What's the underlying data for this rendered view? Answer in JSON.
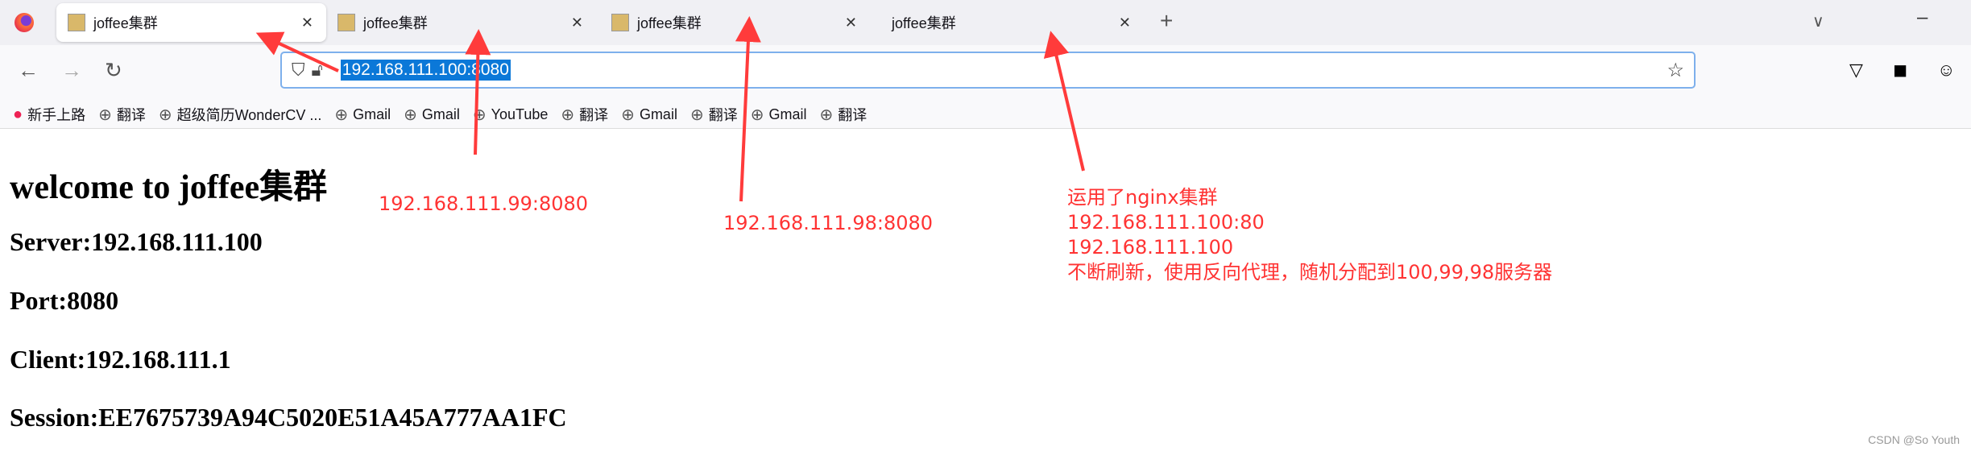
{
  "tabs": [
    {
      "title": "joffee集群",
      "active": true
    },
    {
      "title": "joffee集群"
    },
    {
      "title": "joffee集群"
    },
    {
      "title": "joffee集群"
    }
  ],
  "toolbar": {
    "url": "192.168.111.100:8080"
  },
  "bookmarks": [
    "新手上路",
    "翻译",
    "超级简历WonderCV ...",
    "Gmail",
    "Gmail",
    "YouTube",
    "翻译",
    "Gmail",
    "翻译",
    "Gmail",
    "翻译"
  ],
  "page": {
    "heading": "welcome to joffee集群",
    "server": "Server:192.168.111.100",
    "port": "Port:8080",
    "client": "Client:192.168.111.1",
    "session": "Session:EE7675739A94C5020E51A45A777AA1FC"
  },
  "annotations": {
    "a1": "192.168.111.99:8080",
    "a2": "192.168.111.98:8080",
    "notes": [
      "运用了nginx集群",
      "192.168.111.100:80",
      "192.168.111.100",
      "不断刷新，使用反向代理，随机分配到100,99,98服务器"
    ]
  },
  "watermark": "CSDN @So Youth",
  "colors": {
    "annotation": "#ff3333",
    "selection": "#0b78d8"
  }
}
